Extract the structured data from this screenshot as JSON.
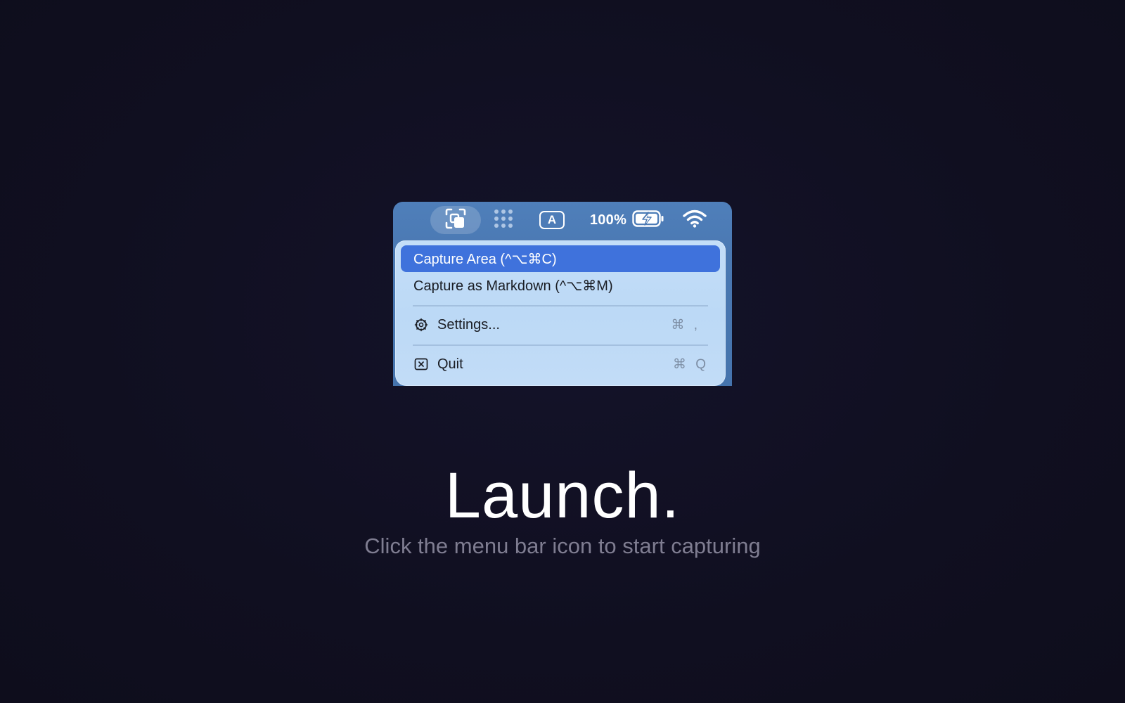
{
  "menubar": {
    "battery_percent": "100%",
    "input_source_label": "A",
    "icons": {
      "capture": "capture-area-icon",
      "grid": "dot-grid-icon",
      "input": "input-source-icon",
      "battery": "battery-charging-icon",
      "wifi": "wifi-icon"
    }
  },
  "menu": {
    "items": [
      {
        "label": "Capture Area (^⌥⌘C)",
        "highlighted": true
      },
      {
        "label": "Capture as Markdown (^⌥⌘M)",
        "highlighted": false
      },
      {
        "label": "Settings...",
        "icon": "gear-icon",
        "shortcut": "⌘ ,"
      },
      {
        "label": "Quit",
        "icon": "close-box-icon",
        "shortcut": "⌘ Q"
      }
    ]
  },
  "hero": {
    "title": "Launch.",
    "subtitle": "Click the menu bar icon to start capturing"
  },
  "colors": {
    "background": "#100f20",
    "menubar": "#4a78b2",
    "menu": "#c0dbf7",
    "highlight": "#3f72dc",
    "subtitle": "#7f7d91"
  }
}
